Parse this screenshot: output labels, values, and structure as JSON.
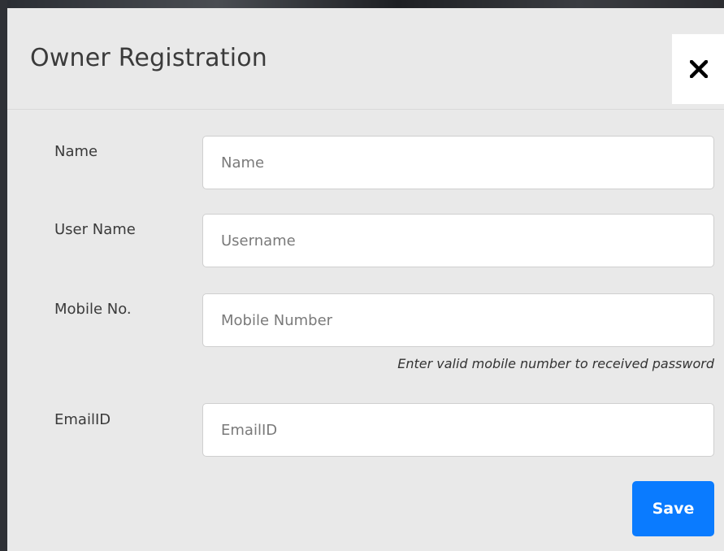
{
  "modal": {
    "title": "Owner Registration",
    "close_icon": "close-icon"
  },
  "form": {
    "fields": [
      {
        "label": "Name",
        "placeholder": "Name",
        "value": ""
      },
      {
        "label": "User Name",
        "placeholder": "Username",
        "value": ""
      },
      {
        "label": "Mobile No.",
        "placeholder": "Mobile Number",
        "value": ""
      },
      {
        "label": "EmailID",
        "placeholder": "EmailID",
        "value": ""
      }
    ],
    "mobile_help": "Enter valid mobile number to received password",
    "save_label": "Save"
  },
  "colors": {
    "primary": "#0a7bff",
    "background": "#e9e9e9"
  }
}
